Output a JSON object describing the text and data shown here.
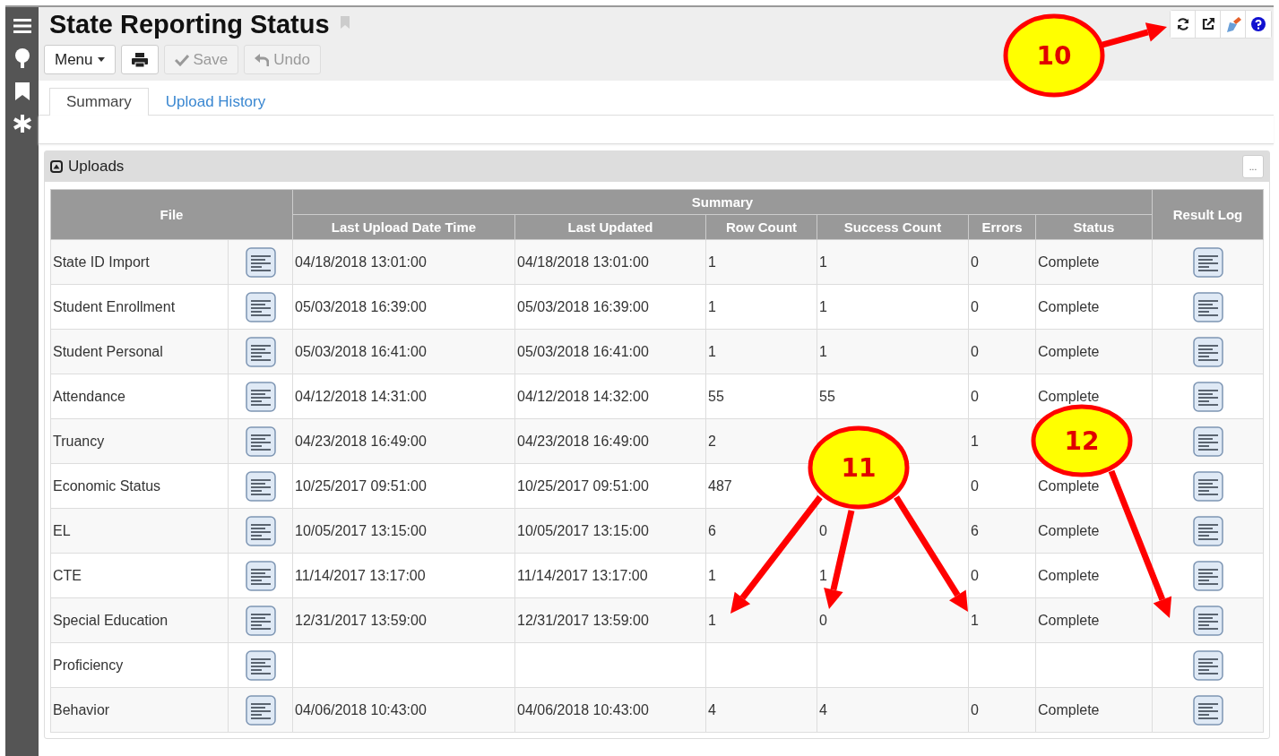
{
  "page": {
    "title": "State Reporting Status"
  },
  "toolbar": {
    "menu": "Menu",
    "save": {
      "label": "Save",
      "disabled": true
    },
    "undo": {
      "label": "Undo",
      "disabled": true
    }
  },
  "tabs": [
    {
      "label": "Summary",
      "selected": true
    },
    {
      "label": "Upload History",
      "selected": false
    }
  ],
  "panel": {
    "title": "Uploads",
    "more": "...",
    "expanded": true
  },
  "table": {
    "file_header": "File",
    "group_header": "Summary",
    "result_header": "Result Log",
    "columns": [
      "Last Upload Date Time",
      "Last Updated",
      "Row Count",
      "Success Count",
      "Errors",
      "Status"
    ],
    "rows": [
      {
        "file": "State ID Import",
        "cells": [
          "04/18/2018 13:01:00",
          "04/18/2018 13:01:00",
          "1",
          "1",
          "0",
          "Complete"
        ]
      },
      {
        "file": "Student Enrollment",
        "cells": [
          "05/03/2018 16:39:00",
          "05/03/2018 16:39:00",
          "1",
          "1",
          "0",
          "Complete"
        ]
      },
      {
        "file": "Student Personal",
        "cells": [
          "05/03/2018 16:41:00",
          "05/03/2018 16:41:00",
          "1",
          "1",
          "0",
          "Complete"
        ]
      },
      {
        "file": "Attendance",
        "cells": [
          "04/12/2018 14:31:00",
          "04/12/2018 14:32:00",
          "55",
          "55",
          "0",
          "Complete"
        ]
      },
      {
        "file": "Truancy",
        "cells": [
          "04/23/2018 16:49:00",
          "04/23/2018 16:49:00",
          "2",
          null,
          "1",
          null
        ]
      },
      {
        "file": "Economic Status",
        "cells": [
          "10/25/2017 09:51:00",
          "10/25/2017 09:51:00",
          "487",
          null,
          "0",
          "Complete"
        ]
      },
      {
        "file": "EL",
        "cells": [
          "10/05/2017 13:15:00",
          "10/05/2017 13:15:00",
          "6",
          "0",
          "6",
          "Complete"
        ]
      },
      {
        "file": "CTE",
        "cells": [
          "11/14/2017 13:17:00",
          "11/14/2017 13:17:00",
          "1",
          "1",
          "0",
          "Complete"
        ]
      },
      {
        "file": "Special Education",
        "cells": [
          "12/31/2017 13:59:00",
          "12/31/2017 13:59:00",
          "1",
          "0",
          "1",
          "Complete"
        ]
      },
      {
        "file": "Proficiency",
        "cells": [
          null,
          null,
          null,
          null,
          null,
          null
        ]
      },
      {
        "file": "Behavior",
        "cells": [
          "04/06/2018 10:43:00",
          "04/06/2018 10:43:00",
          "4",
          "4",
          "0",
          "Complete"
        ]
      }
    ]
  },
  "callouts": [
    {
      "number": "10"
    },
    {
      "number": "11"
    },
    {
      "number": "12"
    }
  ]
}
